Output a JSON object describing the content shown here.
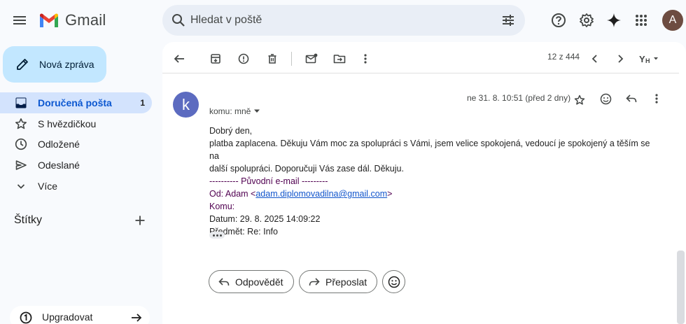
{
  "app": {
    "name": "Gmail",
    "avatar_letter": "A"
  },
  "search": {
    "placeholder": "Hledat v poště"
  },
  "sidebar": {
    "compose_label": "Nová zpráva",
    "items": [
      {
        "label": "Doručená pošta",
        "count": "1",
        "icon": "inbox-icon",
        "active": true
      },
      {
        "label": "S hvězdičkou",
        "count": "",
        "icon": "star-icon",
        "active": false
      },
      {
        "label": "Odložené",
        "count": "",
        "icon": "clock-icon",
        "active": false
      },
      {
        "label": "Odeslané",
        "count": "",
        "icon": "send-icon",
        "active": false
      },
      {
        "label": "Více",
        "count": "",
        "icon": "chevron-down-icon",
        "active": false
      }
    ],
    "labels_heading": "Štítky",
    "upgrade_label": "Upgradovat"
  },
  "toolbar": {
    "pager": "12 z 444"
  },
  "message": {
    "sender_initial": "k",
    "date": "ne 31. 8. 10:51 (před 2 dny)",
    "to_line": "komu: mně",
    "greeting": "Dobrý den,",
    "body_line1": "platba zaplacena. Děkuju Vám moc za spolupráci s Vámi, jsem velice spokojená, vedoucí je spokojený a těším se na",
    "body_line2": "další spolupráci. Doporučuji Vás zase dál. Děkuju.",
    "forward_header": "---------- Původní e-mail ---------",
    "from_prefix": "Od: Adam <",
    "from_email": "adam.diplomovadilna@gmail.com",
    "from_suffix": ">",
    "to_field": "Komu:",
    "date_field": "Datum: 29. 8. 2025 14:09:22",
    "subject_field": "Předmět: Re: Info"
  },
  "actions": {
    "reply_label": "Odpovědět",
    "forward_label": "Přeposlat"
  },
  "colors": {
    "compose_bg": "#c2e7ff",
    "active_nav_bg": "#d3e3fd",
    "link": "#1155cc",
    "forwarded_text": "#500050"
  }
}
